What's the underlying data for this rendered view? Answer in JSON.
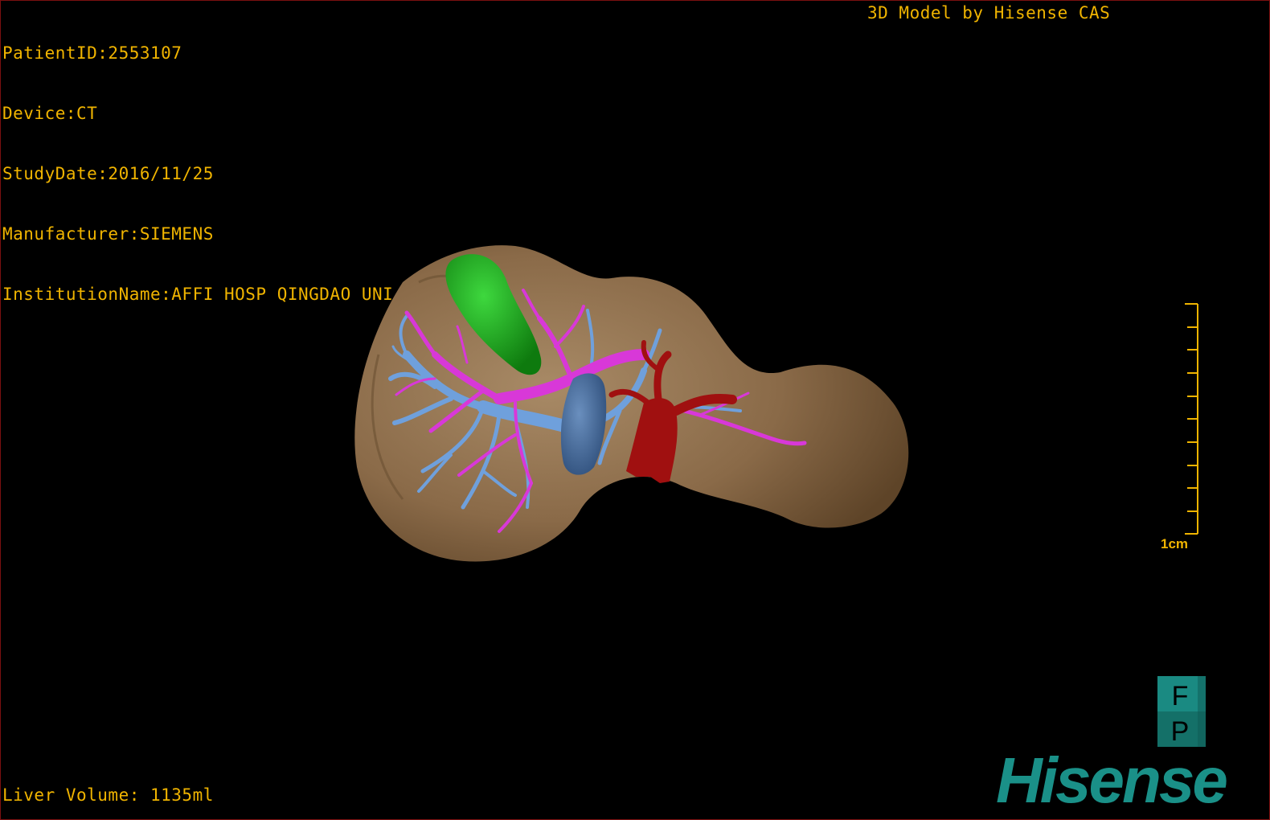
{
  "overlay": {
    "patient_id": "PatientID:2553107",
    "device": "Device:CT",
    "study_date": "StudyDate:2016/11/25",
    "manufacturer": "Manufacturer:SIEMENS",
    "institution": "InstitutionName:AFFI HOSP QINGDAO UNI",
    "credit": "3D Model by Hisense CAS",
    "liver_volume": "Liver Volume: 1135ml"
  },
  "scale_bar": {
    "label": "1cm"
  },
  "orientation_cube": {
    "top_letter": "F",
    "bottom_letter": "P"
  },
  "brand": {
    "logo_text": "Hisense"
  },
  "colors": {
    "overlay_text": "#f0b400",
    "liver": "#8a6a48",
    "gallbladder": "#1eaa1e",
    "portal_vein": "#d838d8",
    "hepatic_vein": "#6fa0dc",
    "vena_cava": "#4a6f9e",
    "artery": "#a01010",
    "logo": "#1a9088"
  }
}
